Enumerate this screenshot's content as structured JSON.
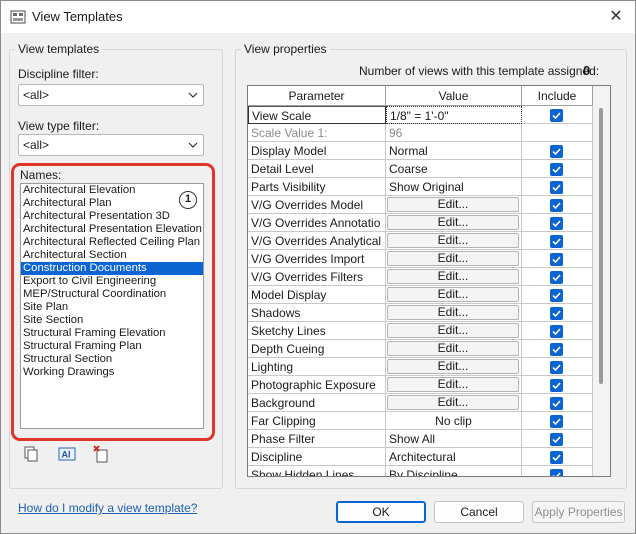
{
  "window": {
    "title": "View Templates",
    "close_glyph": "✕"
  },
  "left_panel": {
    "group_label": "View templates",
    "discipline_filter": {
      "label": "Discipline filter:",
      "value": "<all>"
    },
    "view_type_filter": {
      "label": "View type filter:",
      "value": "<all>"
    },
    "names": {
      "label": "Names:",
      "badge": "1",
      "items": [
        "Architectural Elevation",
        "Architectural Plan",
        "Architectural Presentation 3D",
        "Architectural Presentation Elevation",
        "Architectural Reflected Ceiling Plan",
        "Architectural Section",
        "Construction Documents",
        "Export to Civil Engineering",
        "MEP/Structural Coordination",
        "Site Plan",
        "Site Section",
        "Structural Framing Elevation",
        "Structural Framing Plan",
        "Structural Section",
        "Working Drawings"
      ],
      "selected_index": 6
    },
    "tools": [
      "duplicate-icon",
      "rename-icon",
      "delete-icon"
    ]
  },
  "right_panel": {
    "group_label": "View properties",
    "count_label": "Number of views with this template assigned:",
    "count_value": "0",
    "columns": {
      "parameter": "Parameter",
      "value": "Value",
      "include": "Include"
    },
    "rows": [
      {
        "param": "View Scale",
        "value": "1/8\" = 1'-0\"",
        "kind": "text",
        "include": true,
        "selected": true
      },
      {
        "param": "Scale Value    1:",
        "value": "96",
        "kind": "text",
        "include": null,
        "gray": true
      },
      {
        "param": "Display Model",
        "value": "Normal",
        "kind": "text",
        "include": true
      },
      {
        "param": "Detail Level",
        "value": "Coarse",
        "kind": "text",
        "include": true
      },
      {
        "param": "Parts Visibility",
        "value": "Show Original",
        "kind": "text",
        "include": true
      },
      {
        "param": "V/G Overrides Model",
        "value": "Edit...",
        "kind": "button",
        "include": true
      },
      {
        "param": "V/G Overrides Annotatio",
        "value": "Edit...",
        "kind": "button",
        "include": true
      },
      {
        "param": "V/G Overrides Analytical",
        "value": "Edit...",
        "kind": "button",
        "include": true
      },
      {
        "param": "V/G Overrides Import",
        "value": "Edit...",
        "kind": "button",
        "include": true
      },
      {
        "param": "V/G Overrides Filters",
        "value": "Edit...",
        "kind": "button",
        "include": true
      },
      {
        "param": "Model Display",
        "value": "Edit...",
        "kind": "button",
        "include": true
      },
      {
        "param": "Shadows",
        "value": "Edit...",
        "kind": "button",
        "include": true
      },
      {
        "param": "Sketchy Lines",
        "value": "Edit...",
        "kind": "button",
        "include": true
      },
      {
        "param": "Depth Cueing",
        "value": "Edit...",
        "kind": "button",
        "include": true
      },
      {
        "param": "Lighting",
        "value": "Edit...",
        "kind": "button",
        "include": true
      },
      {
        "param": "Photographic Exposure",
        "value": "Edit...",
        "kind": "button",
        "include": true
      },
      {
        "param": "Background",
        "value": "Edit...",
        "kind": "button",
        "include": true
      },
      {
        "param": "Far Clipping",
        "value": "No clip",
        "kind": "center",
        "include": true
      },
      {
        "param": "Phase Filter",
        "value": "Show All",
        "kind": "text",
        "include": true
      },
      {
        "param": "Discipline",
        "value": "Architectural",
        "kind": "text",
        "include": true
      },
      {
        "param": "Show Hidden Lines",
        "value": "By Discipline",
        "kind": "text",
        "include": true
      }
    ]
  },
  "footer": {
    "help_link": "How do I modify a view template?",
    "ok": "OK",
    "cancel": "Cancel",
    "apply": "Apply Properties"
  },
  "colors": {
    "accent": "#0a64d1",
    "highlight_outline": "#e0352b"
  }
}
